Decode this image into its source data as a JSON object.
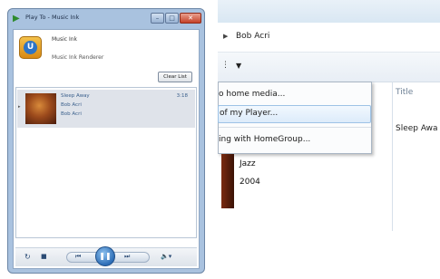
{
  "window": {
    "title": "Play To - Music Ink",
    "minimize_glyph": "–",
    "maximize_glyph": "□",
    "close_glyph": "✕",
    "icon": "play-to-icon"
  },
  "device": {
    "name": "Music Ink",
    "subtitle": "Music Ink Renderer",
    "icon": "media-renderer-icon"
  },
  "clear_list_label": "Clear List",
  "queue": [
    {
      "title": "Sleep Away",
      "artist": "Bob Acri",
      "album": "Bob Acri",
      "duration": "3:18"
    }
  ],
  "controls": {
    "repeat_glyph": "↻",
    "stop_glyph": "■",
    "prev_glyph": "⏮",
    "play_pause_glyph": "❚❚",
    "next_glyph": "⏭",
    "volume_glyph": "🔈▾"
  },
  "right": {
    "breadcrumb": "Bob Acri",
    "toolbar_dots": "⋮",
    "toolbar_arrow": "▼",
    "column_title": "Title",
    "track_title": "Sleep Awa",
    "menu": [
      "o home media...",
      "of my Player...",
      "ing with HomeGroup..."
    ],
    "genre": "Jazz",
    "year": "2004"
  },
  "colors": {
    "accent": "#2d6db6",
    "window_frame": "#a9c2df",
    "close": "#c54127"
  }
}
